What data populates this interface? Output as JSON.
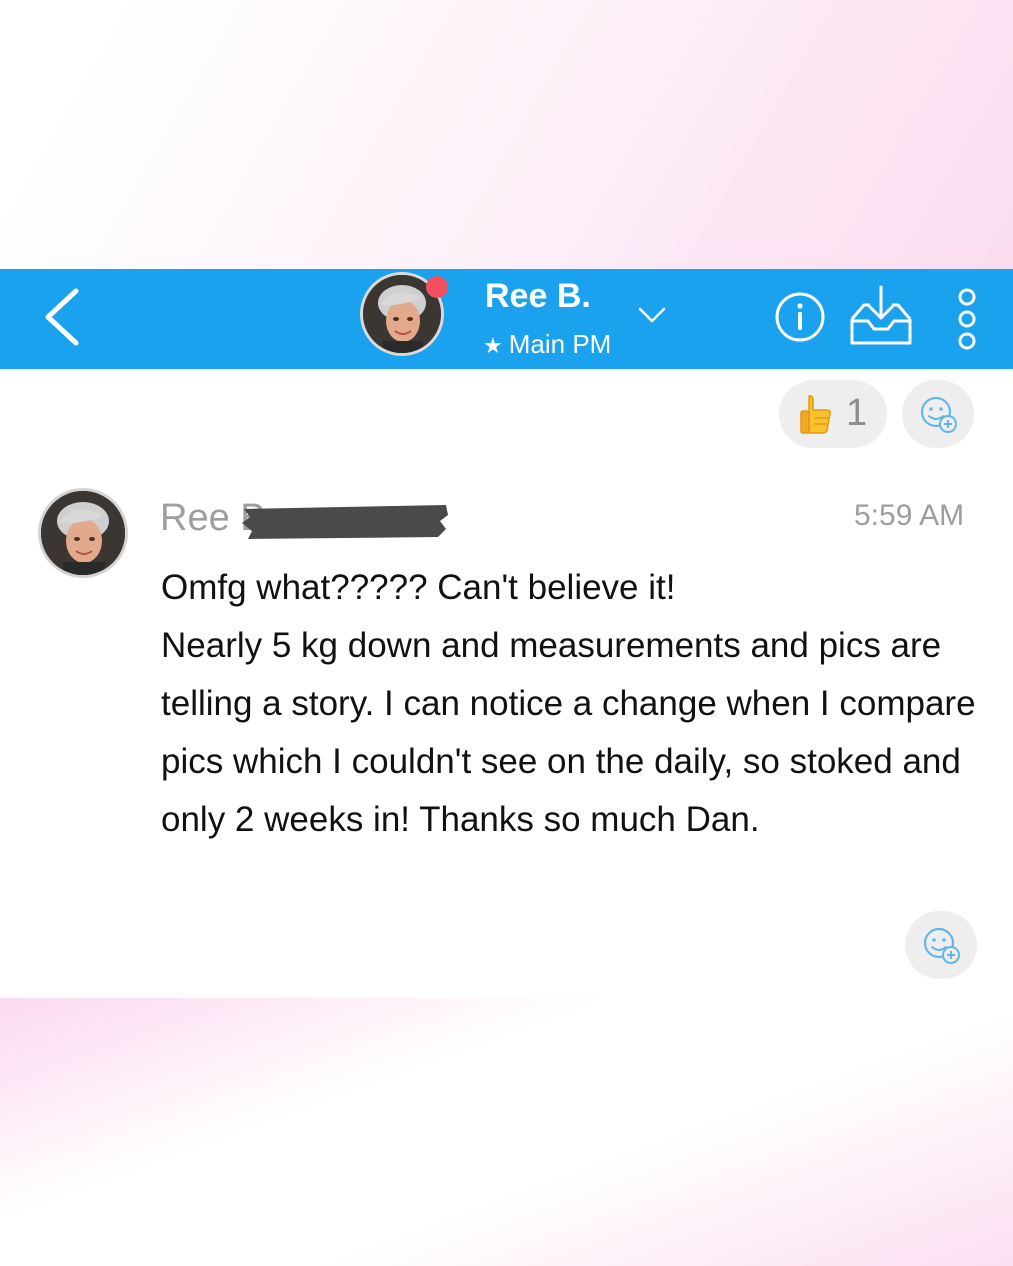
{
  "header": {
    "contact_name": "Ree B.",
    "subtitle_star": "★",
    "subtitle": "Main PM",
    "online": true,
    "icons": [
      "back-chevron-icon",
      "avatar",
      "chevron-down-icon",
      "info-icon",
      "inbox-download-icon",
      "more-vertical-icon"
    ]
  },
  "reactions": {
    "thumbs_up_count": "1"
  },
  "message": {
    "sender": "Ree B",
    "sender_redacted": true,
    "time": "5:59 AM",
    "text": "Omfg what????? Can't believe it!\nNearly 5 kg down and measurements and pics are telling a story. I can notice a change when I compare pics which I couldn't see on the daily, so stoked and only 2 weeks in! Thanks so much Dan."
  },
  "colors": {
    "header_bg": "#1aa2ee",
    "online_dot": "#f2505e",
    "icon_blue": "#62b7e8",
    "pill_bg": "#eeeeee",
    "muted_text": "#9e9e9e"
  }
}
